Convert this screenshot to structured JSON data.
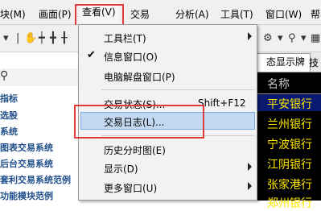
{
  "menubar": {
    "items": [
      {
        "label": "块(M)"
      },
      {
        "label": "画面(P)"
      },
      {
        "label": "查看(V)"
      },
      {
        "label": "交易"
      },
      {
        "label": "分析(A)"
      },
      {
        "label": "工具(T)"
      },
      {
        "label": "窗口(W)"
      },
      {
        "label": "帮"
      }
    ]
  },
  "left_panel": {
    "items": [
      {
        "label": "指标"
      },
      {
        "label": "选股"
      },
      {
        "label": "系统"
      },
      {
        "label": "图表交易系统"
      },
      {
        "label": "后台交易系统"
      },
      {
        "label": "套利交易系统范例"
      },
      {
        "label": "功能模块范例"
      }
    ]
  },
  "dropdown": {
    "items": [
      {
        "label": "工具栏(T)",
        "submenu": true
      },
      {
        "label": "信息窗口(O)",
        "checked": true
      },
      {
        "label": "电脑解盘窗口(P)"
      },
      {
        "label": "交易状态(S)...",
        "shortcut": "Shift+F12"
      },
      {
        "label": "交易日志(L)...",
        "selected": true
      },
      {
        "label": "历史分时图(E)"
      },
      {
        "label": "显示(D)",
        "submenu": true
      },
      {
        "label": "更多窗口(U)",
        "submenu": true
      }
    ]
  },
  "right_panel": {
    "tabs": [
      {
        "label": "态显示牌"
      },
      {
        "label": "技"
      }
    ],
    "header": "名称",
    "rows": [
      {
        "name": "平安银行"
      },
      {
        "name": "兰州银行"
      },
      {
        "name": "宁波银行"
      },
      {
        "name": "江阴银行"
      },
      {
        "name": "张家港行"
      },
      {
        "name": "郑州银行"
      }
    ]
  },
  "colors": {
    "highlight_box": "#e23a3a",
    "quote_text": "#ffe800",
    "tree_text": "#1f4e8a"
  }
}
